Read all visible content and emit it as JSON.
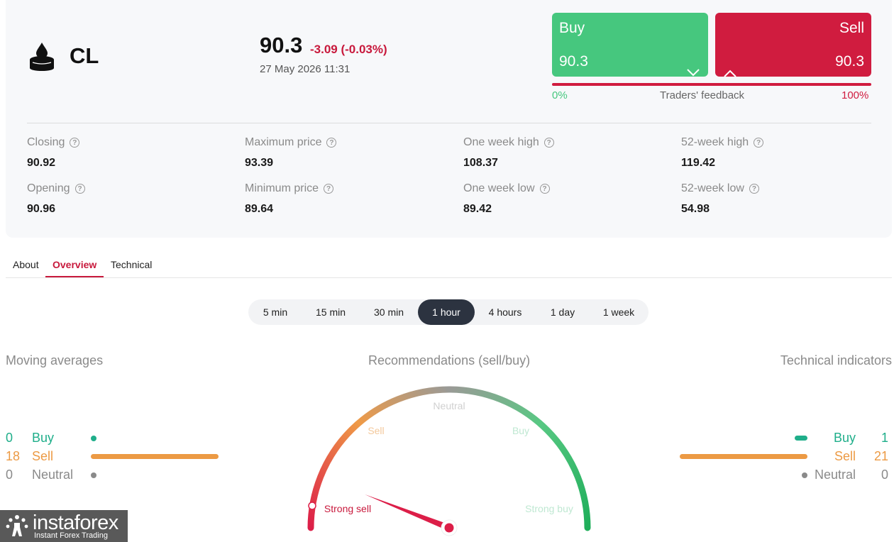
{
  "instrument": {
    "symbol": "CL",
    "icon": "oil-drop-icon",
    "price": "90.3",
    "change": "-3.09 (-0.03%)",
    "datetime": "27 May 2026 11:31"
  },
  "trade": {
    "buy_label": "Buy",
    "buy_price": "90.3",
    "sell_label": "Sell",
    "sell_price": "90.3",
    "feedback_left": "0%",
    "feedback_label": "Traders' feedback",
    "feedback_right": "100%",
    "buy_color": "#46c77e",
    "sell_color": "#d01c3f"
  },
  "stats": [
    {
      "label": "Closing",
      "value": "90.92"
    },
    {
      "label": "Maximum price",
      "value": "93.39"
    },
    {
      "label": "One week high",
      "value": "108.37"
    },
    {
      "label": "52-week high",
      "value": "119.42"
    },
    {
      "label": "Opening",
      "value": "90.96"
    },
    {
      "label": "Minimum price",
      "value": "89.64"
    },
    {
      "label": "One week low",
      "value": "89.42"
    },
    {
      "label": "52-week low",
      "value": "54.98"
    }
  ],
  "tabs": [
    {
      "label": "About",
      "active": false
    },
    {
      "label": "Overview",
      "active": true
    },
    {
      "label": "Technical",
      "active": false
    }
  ],
  "periods": [
    {
      "label": "5 min",
      "active": false
    },
    {
      "label": "15 min",
      "active": false
    },
    {
      "label": "30 min",
      "active": false
    },
    {
      "label": "1 hour",
      "active": true
    },
    {
      "label": "4 hours",
      "active": false
    },
    {
      "label": "1 day",
      "active": false
    },
    {
      "label": "1 week",
      "active": false
    }
  ],
  "moving_averages": {
    "title": "Moving averages",
    "rows": [
      {
        "count": "0",
        "label": "Buy",
        "color": "#1fae8a"
      },
      {
        "count": "18",
        "label": "Sell",
        "color": "#ec9a44"
      },
      {
        "count": "0",
        "label": "Neutral",
        "color": "#8a8a8a"
      }
    ]
  },
  "recommendations": {
    "title": "Recommendations (sell/buy)",
    "labels": {
      "neutral": "Neutral",
      "sell": "Sell",
      "buy": "Buy",
      "strong_sell": "Strong sell",
      "strong_buy": "Strong buy"
    },
    "gauge_level": 0.05
  },
  "technical_indicators": {
    "title": "Technical indicators",
    "rows": [
      {
        "count": "1",
        "label": "Buy",
        "color": "#1fae8a"
      },
      {
        "count": "21",
        "label": "Sell",
        "color": "#ec9a44"
      },
      {
        "count": "0",
        "label": "Neutral",
        "color": "#8a8a8a"
      }
    ]
  },
  "watermark": {
    "brand": "instaforex",
    "tagline": "Instant Forex Trading"
  }
}
